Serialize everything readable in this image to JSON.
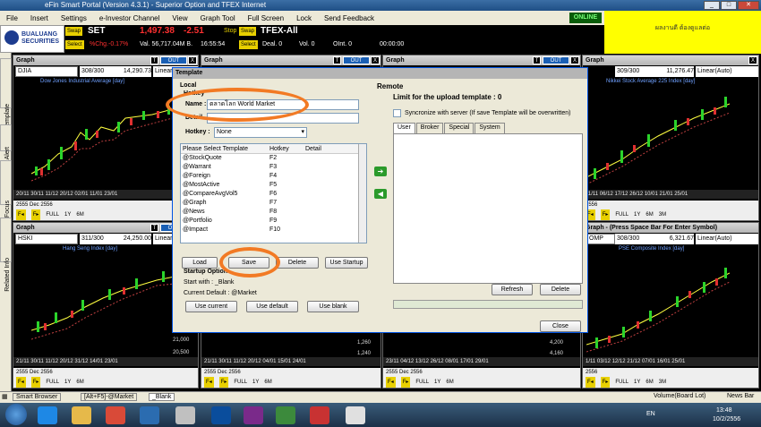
{
  "app": {
    "title": "eFin Smart Portal (Version 4.3.1) - Superior Option and TFEX Internet",
    "online": "ONLINE"
  },
  "menu": [
    "File",
    "Insert",
    "Settings",
    "e-Investor Channel",
    "View",
    "Graph Tool",
    "Full Screen",
    "Lock",
    "Send Feedback"
  ],
  "logo": {
    "line1": "BUALUANG",
    "line2": "SECURITIES"
  },
  "ad_text": "ผลงานดี ต้องดูแลต่อ",
  "ticker": {
    "swap1": "Swap",
    "market": "SET",
    "index": "1,497.38",
    "change": "-2.51",
    "select1": "Select",
    "pct": "%Chg.-0.17%",
    "vol": "Val. 56,717.04M B.",
    "time": "16:55:54",
    "stop": "Stop",
    "swap2": "Swap",
    "tfex": "TFEX-All",
    "select2": "Select",
    "deal": "Deal. 0",
    "vol0": "Vol. 0",
    "oint": "OInt. 0",
    "time2": "00:00:00"
  },
  "side_tabs": [
    "Template",
    "Alert",
    "Stock Focus",
    "Related Info"
  ],
  "panels": [
    {
      "head": "Graph",
      "sym": "DJIA",
      "val": "308/300",
      "price": "14,290.73",
      "scale": "Linear",
      "title": "Dow Jones Industrial Average [day]",
      "dates": "20/11 30/11 11/12 20/12 02/01 11/01 23/01",
      "years": "2555 Dec 2556"
    },
    {
      "head": "Graph",
      "sym": "HSKI",
      "val": "311/300",
      "price": "24,250.00",
      "scale": "Linear",
      "title": "Hang Seng Index [day]",
      "dates": "21/11 30/11 11/12 20/12 31/12 14/01 23/01",
      "years": "2555 Dec 2556"
    },
    {
      "head": "Graph",
      "sym": "",
      "val": "309/300",
      "price": "11,276.47",
      "scale": "Linear(Auto)",
      "title": "Nikkei Stock Average 225 Index [day]",
      "dates": "11/11 06/12 17/12 26/12 10/01 21/01 25/01",
      "years": "2556"
    },
    {
      "head": "Graph - (Press Space Bar For Enter Symbol)",
      "sym": "OMP",
      "val": "308/300",
      "price": "6,321.67",
      "scale": "Linear(Auto)",
      "title": "PSE Composite Index [day]",
      "dates": "1/11 03/12 12/12 21/12 07/01 16/01 25/01",
      "years": "2556"
    }
  ],
  "footer_buttons": [
    "FULL",
    "1Y",
    "6M",
    "3M"
  ],
  "mid_panels": [
    {
      "head": "Graph",
      "dates": "21/11 30/11 11/12 20/12 31/12 14/01 23/01",
      "years": "2555 Dec 2556"
    },
    {
      "head": "Graph",
      "dates": "21/11 30/11 11/12 20/12 04/01 15/01 24/01",
      "years": "2555 Dec 2556"
    },
    {
      "head": "Graph",
      "dates": "23/11 04/12 13/12 26/12 08/01 17/01 29/01",
      "years": "2555 Dec 2556"
    }
  ],
  "mid_scales": [
    "21,000",
    "20,500",
    "1,260",
    "1,240",
    "4,200",
    "4,160"
  ],
  "dialog": {
    "title": "Template",
    "local": "Local",
    "hotkey_group": "Hotkey",
    "name_label": "Name :",
    "name_value": "ตลาดโลก World Market",
    "detail_label": "Detail",
    "hotkey_label": "Hotkey :",
    "hotkey_value": "None",
    "columns": [
      "Please Select Template",
      "Hotkey",
      "Detail"
    ],
    "rows": [
      [
        "@StockQuote",
        "F2",
        ""
      ],
      [
        "@Warrant",
        "F3",
        ""
      ],
      [
        "@Foreign",
        "F4",
        ""
      ],
      [
        "@MostActive",
        "F5",
        ""
      ],
      [
        "@CompareAvgVol5",
        "F6",
        ""
      ],
      [
        "@Graph",
        "F7",
        ""
      ],
      [
        "@News",
        "F8",
        ""
      ],
      [
        "@Portfolio",
        "F9",
        ""
      ],
      [
        "@Impact",
        "F10",
        ""
      ]
    ],
    "load": "Load",
    "save": "Save",
    "delete": "Delete",
    "use_startup": "Use Startup",
    "startup_title": "Startup Option",
    "start_with": "Start with :  _Blank",
    "current_default": "Current Default :  @Market",
    "use_current": "Use current",
    "use_default": "Use default",
    "use_blank": "Use blank",
    "remote": "Remote",
    "limit": "Limit for the upload template :  0",
    "sync": "Syncronize with server  (If save Template will be overwritten)",
    "tabs": [
      "User",
      "Broker",
      "Special",
      "System"
    ],
    "refresh": "Refresh",
    "remote_delete": "Delete",
    "close": "Close"
  },
  "taskbar": {
    "items": [
      "Smart Browser",
      "[Alt+F5]-@Market",
      "_Blank"
    ],
    "volume": "Volume(Board Lot)",
    "news": "News Bar"
  },
  "tray": {
    "lang": "EN",
    "time": "13:48",
    "date": "10/2/2556"
  },
  "colors": {
    "accent_orange": "#f27a24",
    "panel_bg": "#000000",
    "dialog_bg": "#ece9d8",
    "title_blue": "#1f4f86"
  }
}
